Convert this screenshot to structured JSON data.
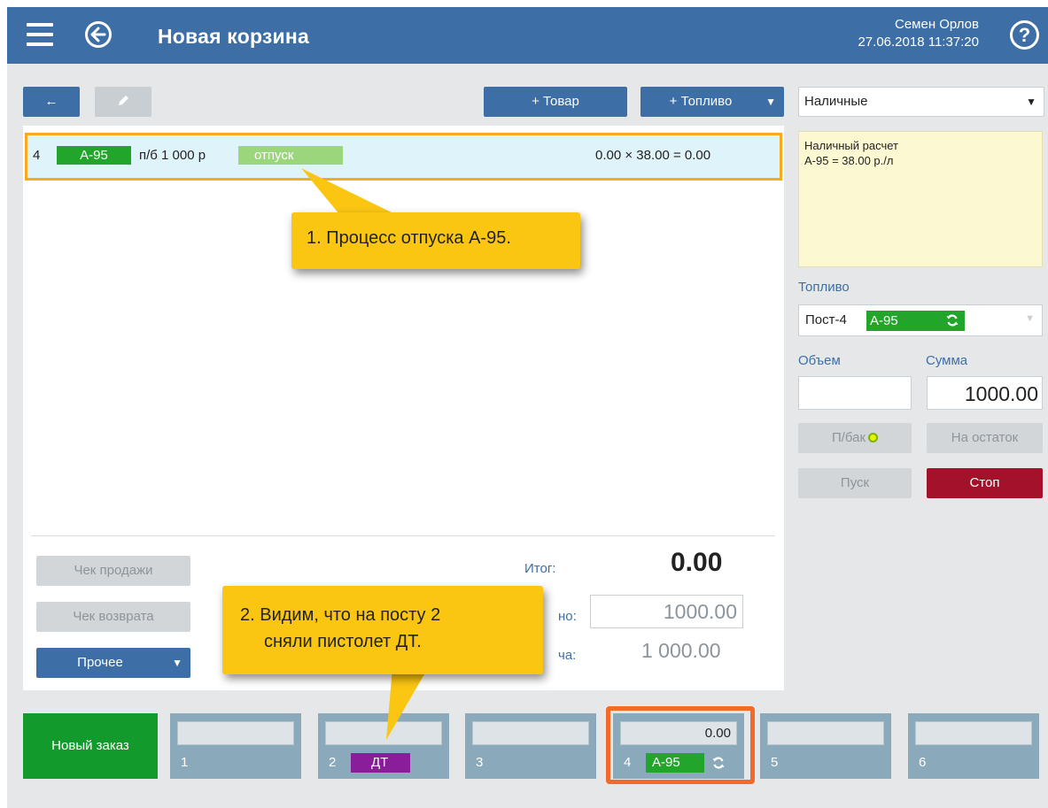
{
  "header": {
    "title": "Новая корзина",
    "user_name": "Семен Орлов",
    "datetime": "27.06.2018 11:37:20",
    "help_label": "?"
  },
  "toolbar": {
    "back_label": "←",
    "add_goods_label": "+ Товар",
    "add_fuel_label": "+ Топливо"
  },
  "order_lines": [
    {
      "num": "4",
      "fuel": "А-95",
      "desc": "п/б 1 000 р",
      "status": "отпуск",
      "calc": "0.00 × 38.00 = 0.00"
    }
  ],
  "actions": {
    "sale_receipt": "Чек продажи",
    "return_receipt": "Чек возврата",
    "other": "Прочее"
  },
  "totals": {
    "itog_label": "Итог:",
    "itog_value": "0.00",
    "label2": "но:",
    "value2": "1000.00",
    "label3": "ча:",
    "value3": "1 000.00"
  },
  "payment": {
    "selected": "Наличные",
    "note_line1": "Наличный расчет",
    "note_line2": "А-95 = 38.00 р./л"
  },
  "fuel_panel": {
    "section_label": "Топливо",
    "post_label": "Пост-4",
    "fuel": "А-95",
    "volume_label": "Объем",
    "volume_value": "",
    "sum_label": "Сумма",
    "sum_value": "1000.00",
    "full_tank_label": "П/бак",
    "remainder_label": "На остаток",
    "start_label": "Пуск",
    "stop_label": "Стоп"
  },
  "callouts": {
    "one": "1. Процесс отпуска А-95.",
    "two_line1": "2. Видим, что на посту 2",
    "two_line2": "сняли пистолет ДТ."
  },
  "pumps": {
    "new_order_label": "Новый заказ",
    "tiles": [
      {
        "num": "1",
        "display": "",
        "fuel": ""
      },
      {
        "num": "2",
        "display": "",
        "fuel": "ДТ"
      },
      {
        "num": "3",
        "display": "",
        "fuel": ""
      },
      {
        "num": "4",
        "display": "0.00",
        "fuel": "А-95"
      },
      {
        "num": "5",
        "display": "",
        "fuel": ""
      },
      {
        "num": "6",
        "display": "",
        "fuel": ""
      }
    ]
  },
  "colors": {
    "header_blue": "#3d6fa6",
    "a95_green": "#22a52b",
    "dt_purple": "#8a1e9a",
    "stop_red": "#a3122a",
    "new_order_green": "#139a2c",
    "callout_yellow": "#fbc612",
    "highlight_orange": "#f26a2a",
    "line_highlight": "#f6aa1c"
  }
}
